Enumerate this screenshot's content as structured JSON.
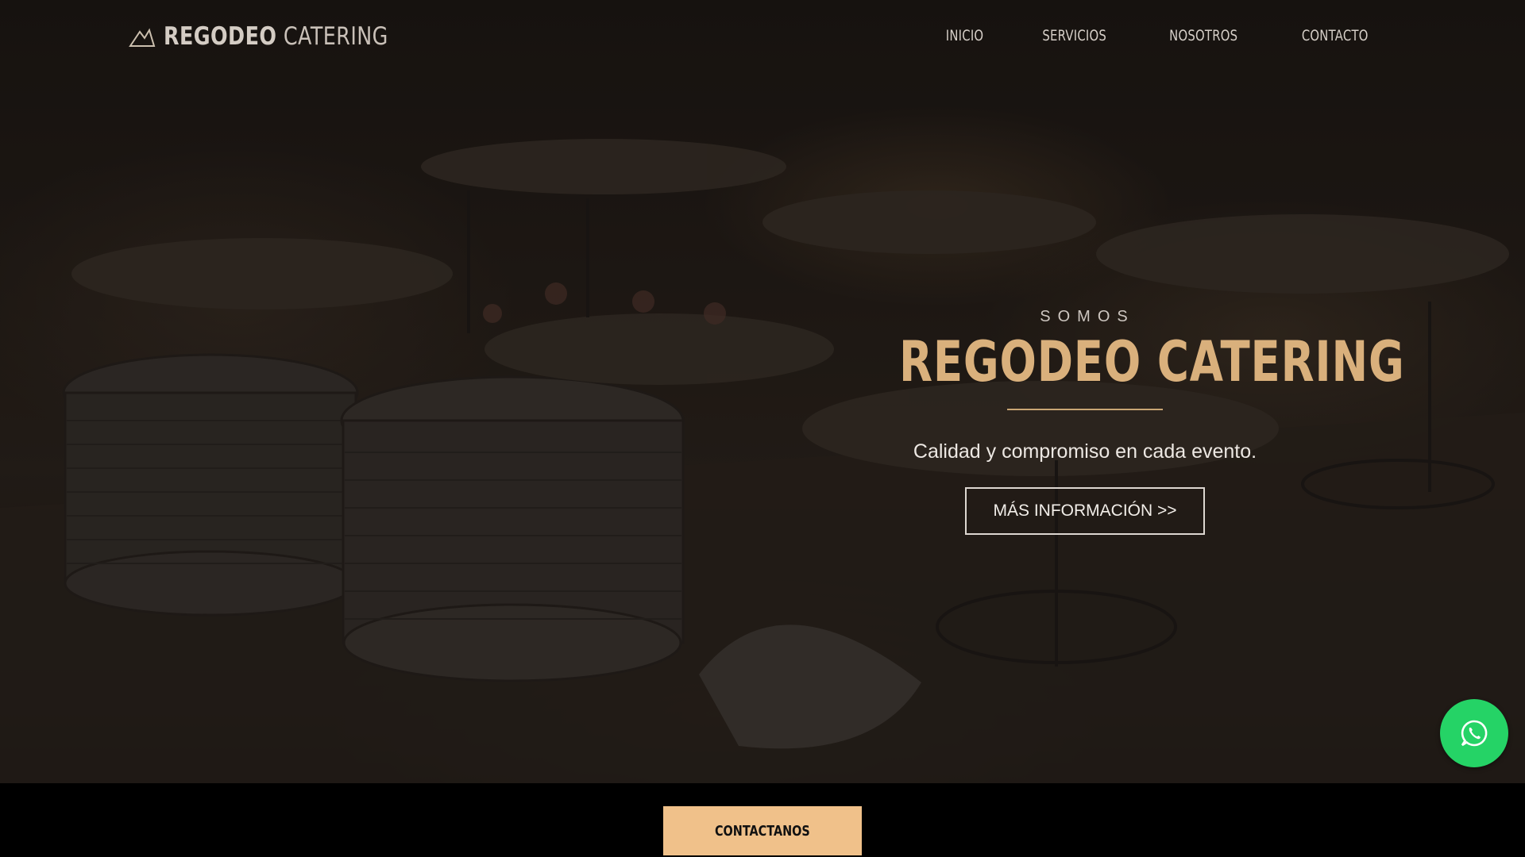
{
  "header": {
    "logo_bold": "REGODEO",
    "logo_light": "CATERING",
    "nav": [
      "INICIO",
      "SERVICIOS",
      "NOSOTROS",
      "CONTACTO"
    ]
  },
  "hero": {
    "kicker": "SOMOS",
    "title": "REGODEO CATERING",
    "subtitle": "Calidad y compromiso en cada evento.",
    "cta_label": "MÁS INFORMACIÓN >>"
  },
  "footer_bar": {
    "contact_label": "CONTACTANOS"
  },
  "icons": {
    "logo": "chef-hat-icon",
    "floating": "whatsapp-icon"
  },
  "colors": {
    "accent_gold": "#d9b07c",
    "contact_button": "#f0c18a",
    "whatsapp_green": "#25d366"
  }
}
